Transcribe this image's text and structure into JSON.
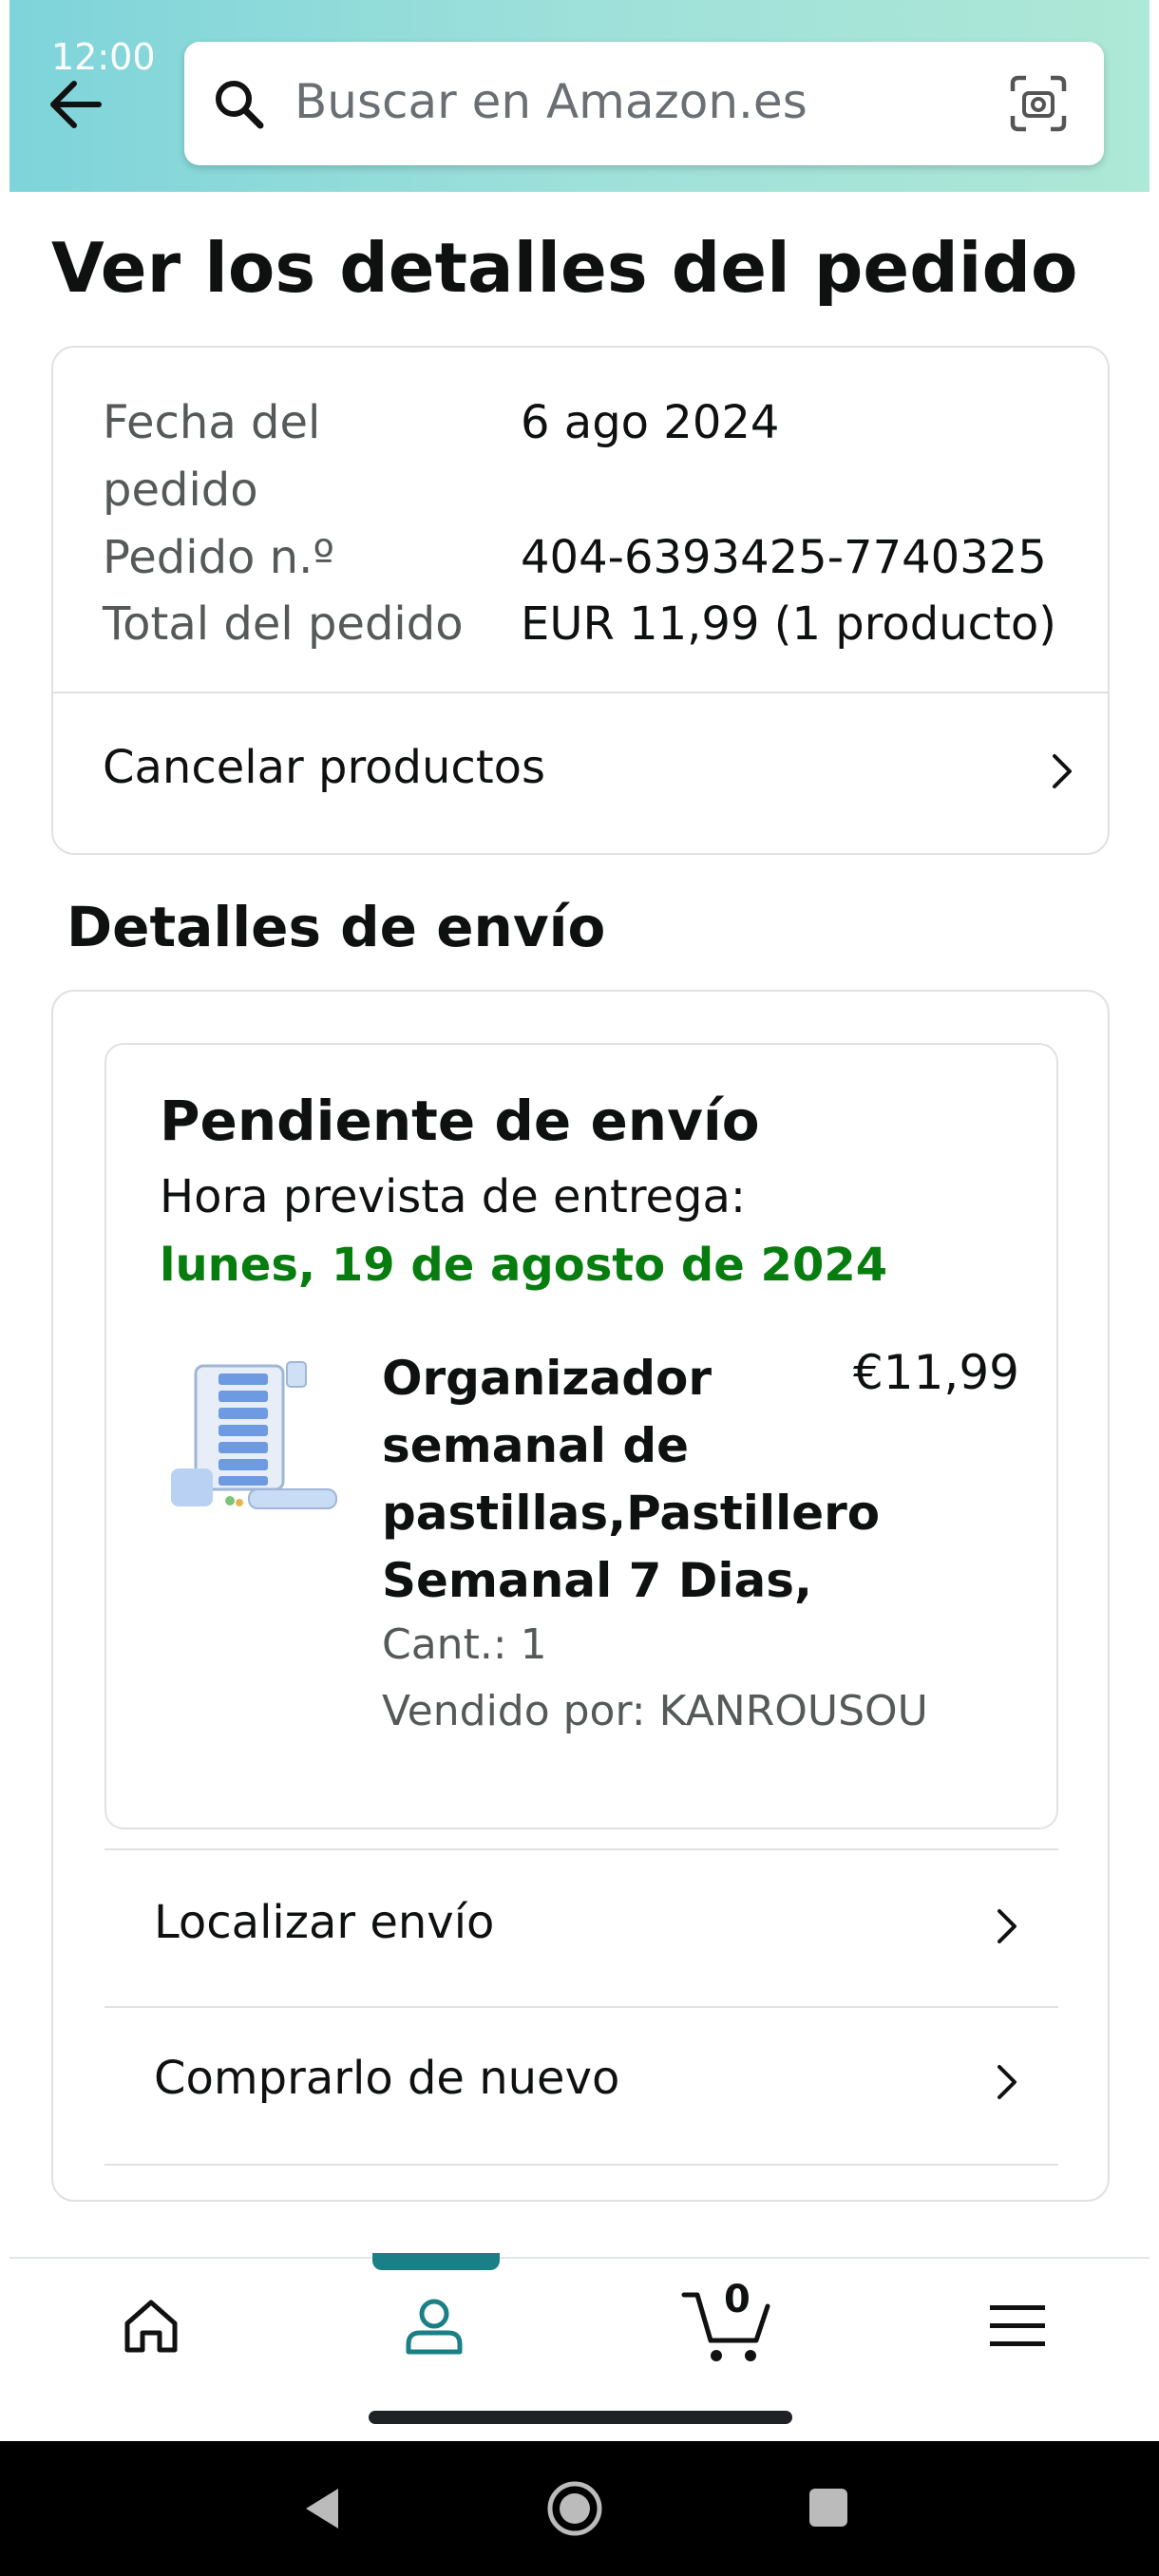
{
  "status_bar": {
    "time": "12:00"
  },
  "search": {
    "placeholder": "Buscar en Amazon.es"
  },
  "page_title": "Ver los detalles del pedido",
  "order_summary": {
    "date_label": "Fecha del pedido",
    "date_value": "6 ago 2024",
    "number_label": "Pedido n.º",
    "number_value": "404-6393425-7740325",
    "total_label": "Total del pedido",
    "total_value": "EUR 11,99 (1 producto)",
    "cancel_label": "Cancelar productos"
  },
  "shipping": {
    "section_title": "Detalles de envío",
    "status": "Pendiente de envío",
    "eta_label": "Hora prevista de entrega:",
    "eta_value": "lunes, 19 de agosto de 2024",
    "product": {
      "title_lines": [
        "Organizador",
        "semanal de",
        "pastillas,Pastillero",
        "Semanal 7 Dias,"
      ],
      "price": "€11,99",
      "qty": "Cant.: 1",
      "seller": "Vendido por: KANROUSOU"
    },
    "track_label": "Localizar envío",
    "buy_again_label": "Comprarlo de nuevo"
  },
  "bottom_nav": {
    "cart_count": "0",
    "active_tab": "account"
  },
  "colors": {
    "accent": "#1a7f86",
    "delivery_green": "#067d0e"
  }
}
